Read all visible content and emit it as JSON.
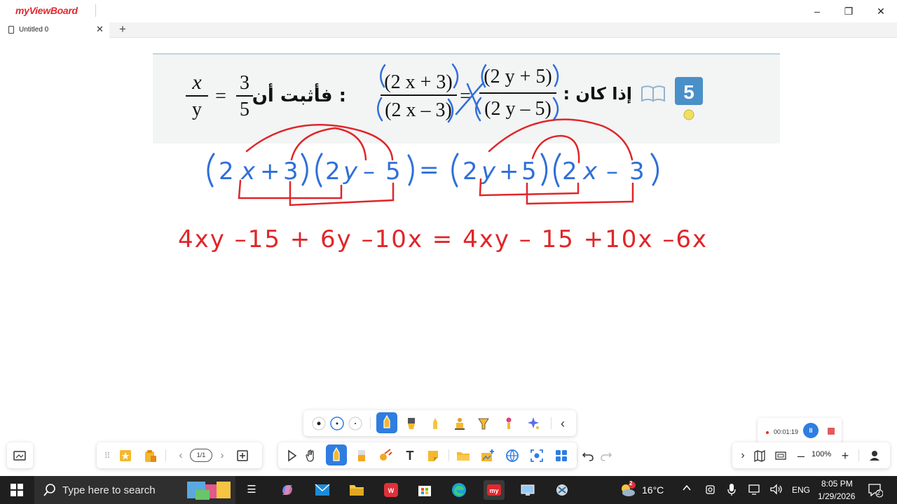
{
  "app": {
    "logo": "myViewBoard"
  },
  "window_controls": {
    "minimize": "–",
    "restore": "❐",
    "close": "✕"
  },
  "tab": {
    "title": "Untitled 0",
    "close": "✕",
    "add": "+"
  },
  "problem": {
    "number": "5",
    "lhs_num": "(2 x + 3)",
    "lhs_den": "(2 x – 3)",
    "rhs_num": "(2 y + 5)",
    "rhs_den": "(2 y – 5)",
    "if_text": ": إذا كان",
    "prove_text": "فأثبت أن :",
    "res_x": "x",
    "res_y": "y",
    "res_eq": "=",
    "res_3": "3",
    "res_5": "5",
    "eq_sign": "="
  },
  "handwriting": {
    "line1": [
      "(",
      "2",
      "x",
      "+",
      "3",
      ")",
      "(",
      "2",
      "y",
      "–",
      "5",
      ")",
      "=",
      "(",
      "2",
      "y",
      "+",
      "5",
      ")",
      "(",
      "2",
      "x",
      "–",
      "3",
      ")"
    ],
    "line2": "4xy –15 + 6y –10x = 4xy – 15 +10x –6x"
  },
  "recording": {
    "time": "00:01:19",
    "pause": "II"
  },
  "pen_toolbar": {
    "sizes": [
      "small-dot",
      "medium-dot",
      "large-dot"
    ],
    "tools": [
      "pen",
      "marker",
      "highlighter",
      "brush",
      "calligraphy",
      "glow-pen",
      "magic-pen"
    ],
    "collapse": "‹"
  },
  "left_bar": {
    "page": "1/1",
    "prev": "‹",
    "next": "›",
    "add": "+"
  },
  "right_bar": {
    "zoom": "100%",
    "expand": "›",
    "minus": "–",
    "plus": "+"
  },
  "taskbar": {
    "search_placeholder": "Type here to search",
    "weather": "16°C",
    "lang": "ENG",
    "time": "8:05 PM",
    "date": "1/29/2026",
    "notification_count": "2",
    "weather_badge": "2"
  },
  "colors": {
    "accent": "#2f7de1",
    "ink_blue": "#2f6fd8",
    "ink_red": "#e0262a",
    "brand_red": "#e0282e",
    "problem_badge": "#4a90c8"
  }
}
